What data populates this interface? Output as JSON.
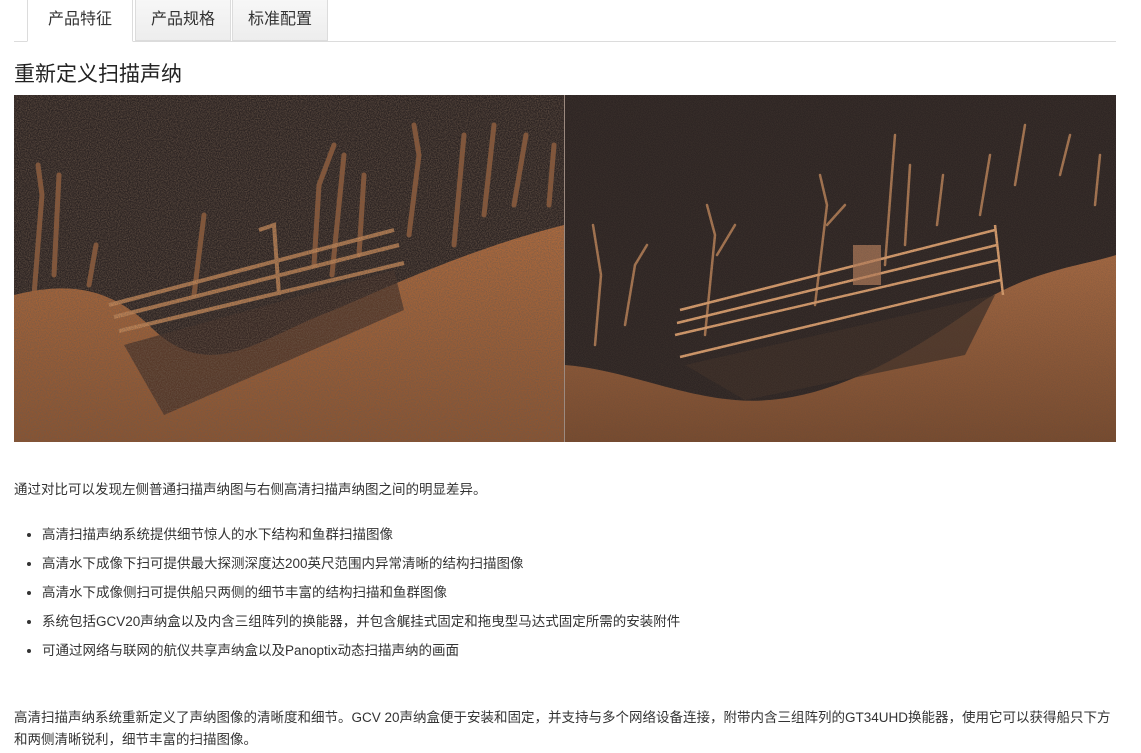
{
  "tabs": [
    {
      "label": "产品特征",
      "active": true
    },
    {
      "label": "产品规格",
      "active": false
    },
    {
      "label": "标准配置",
      "active": false
    }
  ],
  "heading": "重新定义扫描声纳",
  "comparison_image": {
    "left": "standard-sidescan-sonar-image",
    "right": "high-definition-sidescan-sonar-image",
    "colors": {
      "background": "#2a2322",
      "echo": "#c47a47",
      "echo_bright": "#e0a270"
    }
  },
  "compare_text": "通过对比可以发现左侧普通扫描声纳图与右侧高清扫描声纳图之间的明显差异。",
  "features": [
    "高清扫描声纳系统提供细节惊人的水下结构和鱼群扫描图像",
    "高清水下成像下扫可提供最大探测深度达200英尺范围内异常清晰的结构扫描图像",
    "高清水下成像侧扫可提供船只两侧的细节丰富的结构扫描和鱼群图像",
    "系统包括GCV20声纳盒以及内含三组阵列的换能器，并包含艉挂式固定和拖曳型马达式固定所需的安装附件",
    "可通过网络与联网的航仪共享声纳盒以及Panoptix动态扫描声纳的画面"
  ],
  "summary": "高清扫描声纳系统重新定义了声纳图像的清晰度和细节。GCV 20声纳盒便于安装和固定，并支持与多个网络设备连接，附带内含三组阵列的GT34UHD换能器，使用它可以获得船只下方和两侧清晰锐利，细节丰富的扫描图像。"
}
